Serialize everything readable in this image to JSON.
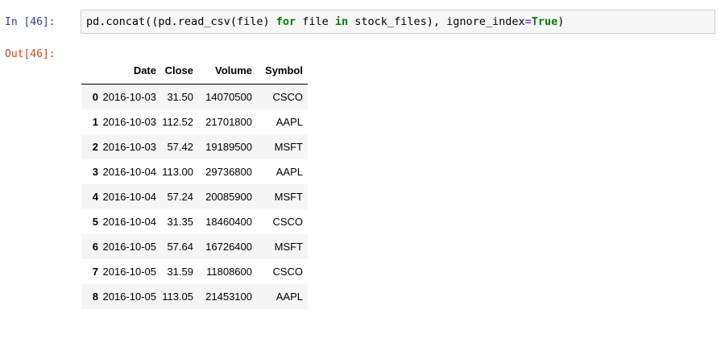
{
  "cell": {
    "in_prompt": "In [46]:",
    "out_prompt": "Out[46]:",
    "code_tokens": [
      {
        "text": "pd.concat(",
        "type": "plain"
      },
      {
        "text": "(",
        "type": "paren"
      },
      {
        "text": "pd.read_csv(file) ",
        "type": "plain"
      },
      {
        "text": "for",
        "type": "kw"
      },
      {
        "text": " file ",
        "type": "plain"
      },
      {
        "text": "in",
        "type": "kw"
      },
      {
        "text": " stock_files), ignore_index",
        "type": "plain"
      },
      {
        "text": "=",
        "type": "op"
      },
      {
        "text": "True",
        "type": "const"
      },
      {
        "text": ")",
        "type": "plain"
      }
    ]
  },
  "table": {
    "columns": [
      "",
      "Date",
      "Close",
      "Volume",
      "Symbol"
    ],
    "rows": [
      {
        "index": "0",
        "Date": "2016-10-03",
        "Close": "31.50",
        "Volume": "14070500",
        "Symbol": "CSCO"
      },
      {
        "index": "1",
        "Date": "2016-10-03",
        "Close": "112.52",
        "Volume": "21701800",
        "Symbol": "AAPL"
      },
      {
        "index": "2",
        "Date": "2016-10-03",
        "Close": "57.42",
        "Volume": "19189500",
        "Symbol": "MSFT"
      },
      {
        "index": "3",
        "Date": "2016-10-04",
        "Close": "113.00",
        "Volume": "29736800",
        "Symbol": "AAPL"
      },
      {
        "index": "4",
        "Date": "2016-10-04",
        "Close": "57.24",
        "Volume": "20085900",
        "Symbol": "MSFT"
      },
      {
        "index": "5",
        "Date": "2016-10-04",
        "Close": "31.35",
        "Volume": "18460400",
        "Symbol": "CSCO"
      },
      {
        "index": "6",
        "Date": "2016-10-05",
        "Close": "57.64",
        "Volume": "16726400",
        "Symbol": "MSFT"
      },
      {
        "index": "7",
        "Date": "2016-10-05",
        "Close": "31.59",
        "Volume": "11808600",
        "Symbol": "CSCO"
      },
      {
        "index": "8",
        "Date": "2016-10-05",
        "Close": "113.05",
        "Volume": "21453100",
        "Symbol": "AAPL"
      }
    ]
  }
}
